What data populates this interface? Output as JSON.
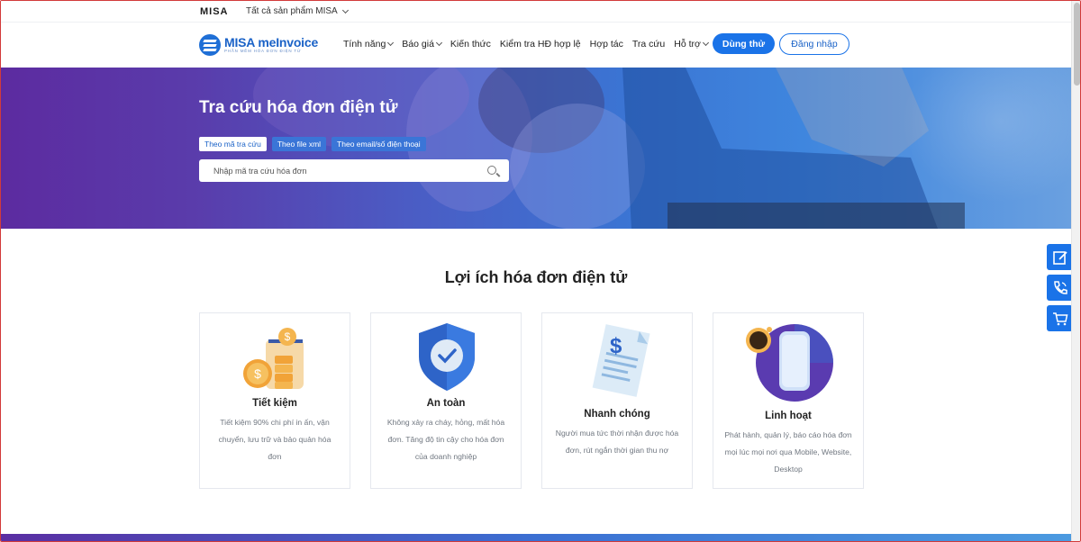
{
  "topbar": {
    "logo": "MISA",
    "all_products": "Tất cả sản phẩm MISA"
  },
  "brand": {
    "name": "MISA meInvoice",
    "tagline": "PHẦN MỀM HÓA ĐƠN ĐIỆN TỬ"
  },
  "nav": {
    "items": [
      {
        "label": "Tính năng",
        "has_dropdown": true
      },
      {
        "label": "Báo giá",
        "has_dropdown": true
      },
      {
        "label": "Kiến thức",
        "has_dropdown": false
      },
      {
        "label": "Kiểm tra HĐ hợp lệ",
        "has_dropdown": false
      },
      {
        "label": "Hợp tác",
        "has_dropdown": false
      },
      {
        "label": "Tra cứu",
        "has_dropdown": false
      },
      {
        "label": "Hỗ trợ",
        "has_dropdown": true
      }
    ],
    "trial_button": "Dùng thử",
    "login_button": "Đăng nhập"
  },
  "hero": {
    "title": "Tra cứu hóa đơn điện tử",
    "tabs": [
      {
        "label": "Theo mã tra cứu",
        "active": true
      },
      {
        "label": "Theo file xml",
        "active": false
      },
      {
        "label": "Theo email/số điện thoại",
        "active": false
      }
    ],
    "search_placeholder": "Nhập mã tra cứu hóa đơn"
  },
  "benefits": {
    "title": "Lợi ích hóa đơn điện tử",
    "cards": [
      {
        "title": "Tiết kiệm",
        "desc": "Tiết kiệm 90% chi phí in ấn, vận chuyển, lưu trữ và bảo quản hóa đơn",
        "icon": "coins-jar-icon"
      },
      {
        "title": "An toàn",
        "desc": "Không xảy ra cháy, hỏng, mất hóa đơn. Tăng độ tin cậy cho hóa đơn của doanh nghiệp",
        "icon": "shield-check-icon"
      },
      {
        "title": "Nhanh chóng",
        "desc": "Người mua tức thời nhận được hóa đơn, rút ngắn thời gian thu nợ",
        "icon": "invoice-dollar-icon"
      },
      {
        "title": "Linh hoạt",
        "desc": "Phát hành, quản lý, báo cáo hóa đơn mọi lúc mọi nơi qua Mobile, Website, Desktop",
        "icon": "mobile-coffee-icon"
      }
    ]
  },
  "floating": [
    "edit-icon",
    "phone-icon",
    "cart-icon"
  ],
  "colors": {
    "primary": "#1a73e8",
    "brand": "#1a62c7",
    "hero_start": "#5c2ba0",
    "hero_end": "#6aa0e0"
  }
}
